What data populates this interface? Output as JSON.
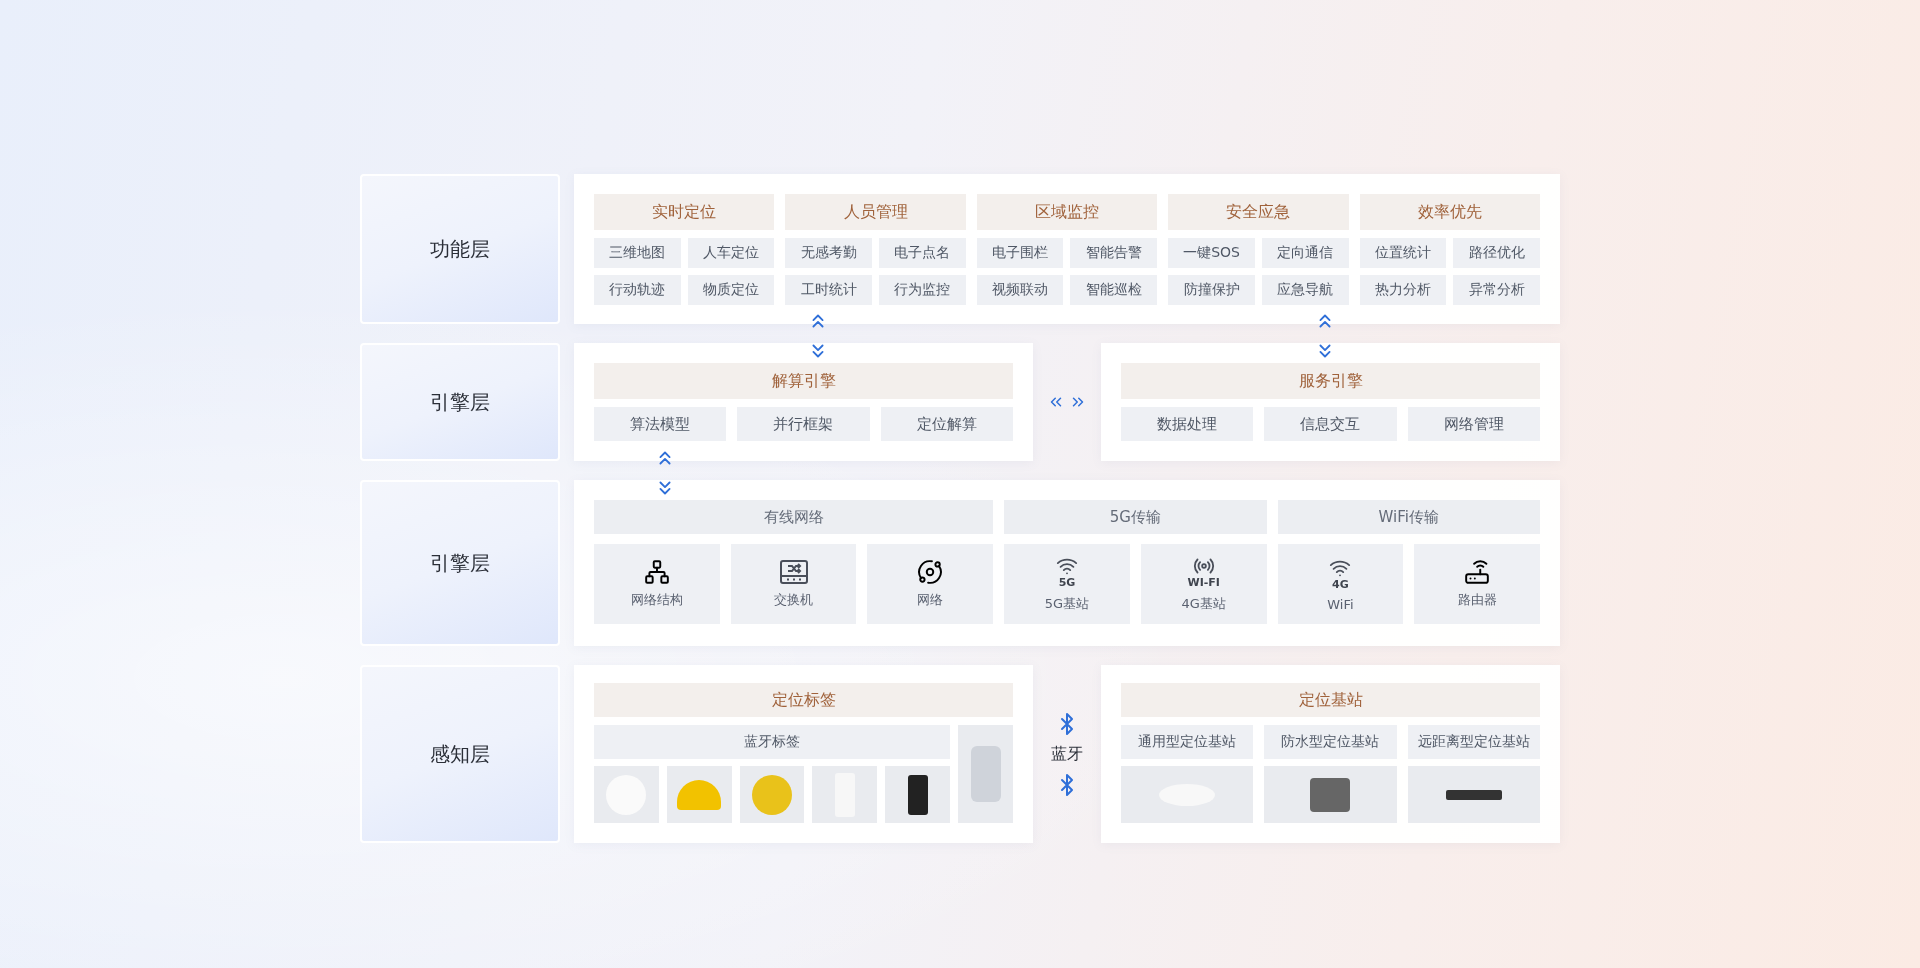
{
  "layers": [
    {
      "kind": "function",
      "label": "功能层",
      "groups": [
        {
          "title": "实时定位",
          "items": [
            "三维地图",
            "人车定位",
            "行动轨迹",
            "物质定位"
          ]
        },
        {
          "title": "人员管理",
          "items": [
            "无感考勤",
            "电子点名",
            "工时统计",
            "行为监控"
          ]
        },
        {
          "title": "区域监控",
          "items": [
            "电子围栏",
            "智能告警",
            "视频联动",
            "智能巡检"
          ]
        },
        {
          "title": "安全应急",
          "items": [
            "一键SOS",
            "定向通信",
            "防撞保护",
            "应急导航"
          ]
        },
        {
          "title": "效率优先",
          "items": [
            "位置统计",
            "路径优化",
            "热力分析",
            "异常分析"
          ]
        }
      ]
    },
    {
      "kind": "engine",
      "label": "引擎层",
      "panels": [
        {
          "title": "解算引擎",
          "items": [
            "算法模型",
            "并行框架",
            "定位解算"
          ]
        },
        {
          "title": "服务引擎",
          "items": [
            "数据处理",
            "信息交互",
            "网络管理"
          ]
        }
      ]
    },
    {
      "kind": "network",
      "label": "引擎层",
      "groups": [
        {
          "title": "有线网络",
          "devices": [
            {
              "label": "网络结构"
            },
            {
              "label": "交换机"
            },
            {
              "label": "网络"
            }
          ]
        },
        {
          "title": "5G传输",
          "devices": [
            {
              "label": "5G基站",
              "icon_text": "5G"
            },
            {
              "label": "4G基站",
              "icon_text": "WI-FI"
            }
          ]
        },
        {
          "title": "WiFi传输",
          "devices": [
            {
              "label": "WiFi",
              "icon_text": "4G"
            },
            {
              "label": "路由器"
            }
          ]
        }
      ]
    },
    {
      "kind": "perception",
      "label": "感知层",
      "tags": {
        "title": "定位标签",
        "subtitle": "蓝牙标签"
      },
      "link": "蓝牙",
      "stations": {
        "title": "定位基站",
        "items": [
          "通用型定位基站",
          "防水型定位基站",
          "远距离型定位基站"
        ]
      }
    }
  ]
}
